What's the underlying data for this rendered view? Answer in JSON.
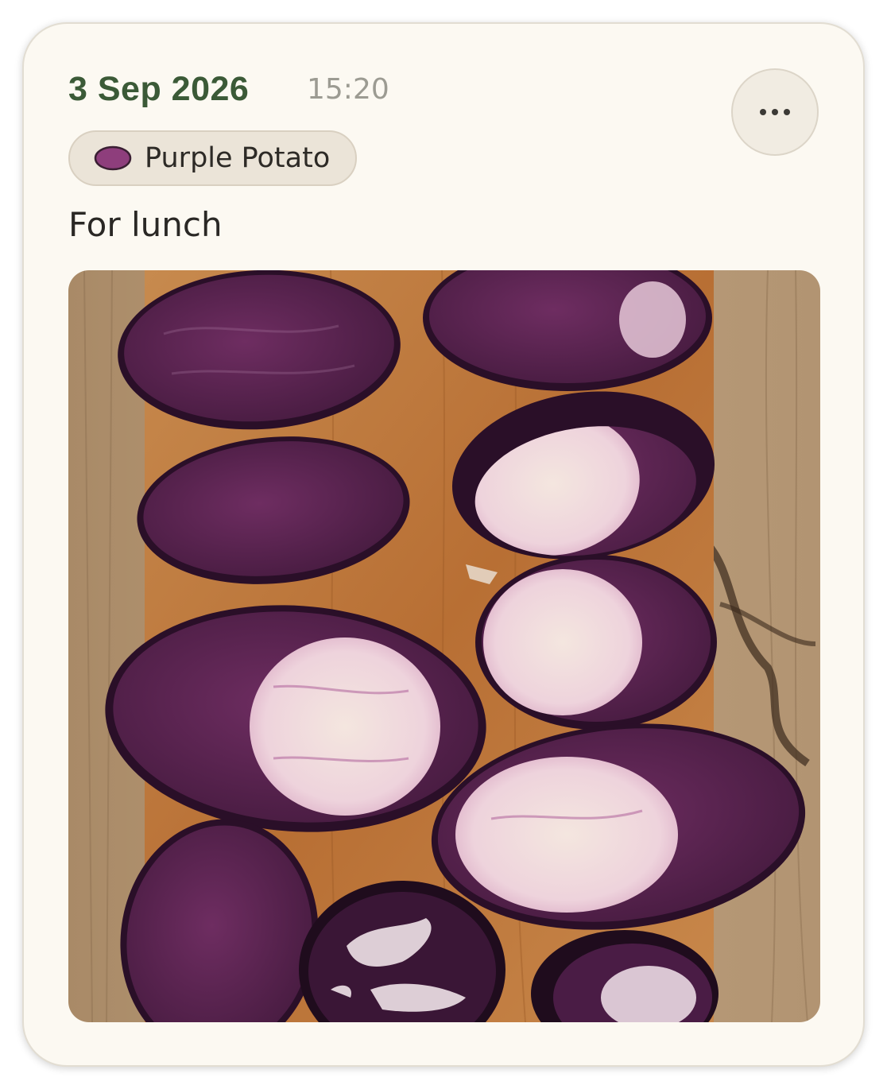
{
  "entry": {
    "date": "3 Sep 2026",
    "time": "15:20",
    "tag": {
      "label": "Purple Potato",
      "icon": "purple-potato-icon",
      "color": "#8e3e7c"
    },
    "note": "For lunch",
    "more_icon": "ellipsis-icon",
    "photo_subject": "purple-potato-halves-on-wooden-board"
  },
  "colors": {
    "date_green": "#3b5a37",
    "card_background": "#fcf9f2",
    "tag_background": "#ebe4d8"
  }
}
